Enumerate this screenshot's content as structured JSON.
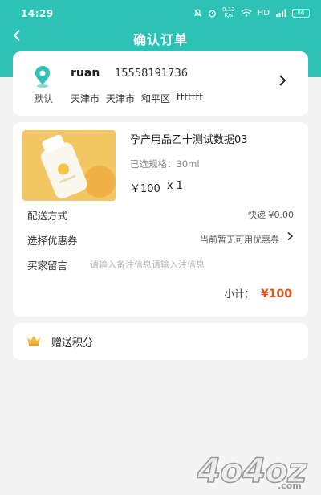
{
  "status_bar": {
    "time": "14:29",
    "net_speed_value": "0.12",
    "net_speed_unit": "K/s",
    "network_type": "HD",
    "battery": "66"
  },
  "header": {
    "title": "确认订单"
  },
  "address": {
    "default_label": "默认",
    "name": "ruan",
    "phone": "15558191736",
    "province": "天津市",
    "city": "天津市",
    "district": "和平区",
    "detail": "ttttttt"
  },
  "product": {
    "name": "孕产用品乙十测试数据03",
    "spec": "已选规格：30ml",
    "price": "￥100",
    "quantity": "x 1"
  },
  "order": {
    "shipping_label": "配送方式",
    "shipping_value": "快递 ¥0.00",
    "coupon_label": "选择优惠券",
    "coupon_value": "当前暂无可用优惠券",
    "note_label": "买家留言",
    "note_placeholder": "请输入备注信息请输入注信息",
    "subtotal_label": "小计：",
    "subtotal_value": "¥100"
  },
  "points": {
    "label": "赠送积分"
  },
  "watermark": {
    "text": "4o4oz",
    "suffix": ".com"
  },
  "colors": {
    "accent": "#2cc2b6",
    "price": "#e2551c"
  },
  "icons": [
    "back-arrow-icon",
    "location-pin-icon",
    "chevron-right-icon",
    "crown-icon"
  ]
}
